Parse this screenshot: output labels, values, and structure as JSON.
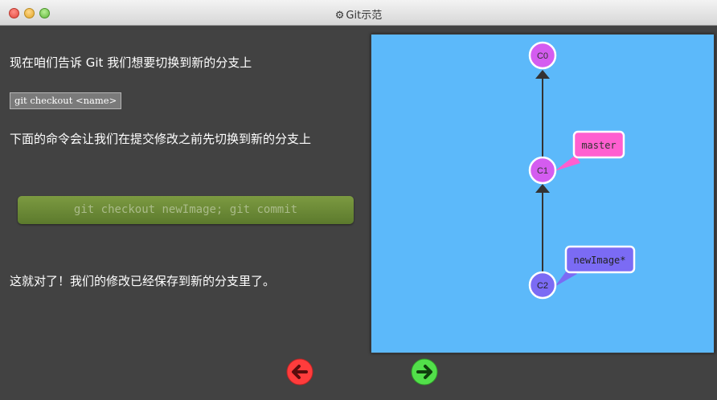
{
  "window": {
    "title": "Git示范",
    "title_icon": "gear-icon"
  },
  "dialog": {
    "paragraph_1": "现在咱们告诉 Git 我们想要切换到新的分支上",
    "code_example": "git checkout <name>",
    "paragraph_2": "下面的命令会让我们在提交修改之前先切换到新的分支上",
    "command": "git checkout newImage; git commit",
    "paragraph_3": "这就对了！我们的修改已经保存到新的分支里了。"
  },
  "navigation": {
    "prev_icon": "arrow-left-icon",
    "next_icon": "arrow-right-icon",
    "prev_color": "#ff3c3c",
    "next_color": "#52e04a"
  },
  "graph": {
    "commits": [
      {
        "id": "C0",
        "color": "#d45cf0"
      },
      {
        "id": "C1",
        "color": "#d45cf0"
      },
      {
        "id": "C2",
        "color": "#7b6bf4"
      }
    ],
    "branches": [
      {
        "label": "master",
        "target": "C1",
        "color": "#ff5fd0"
      },
      {
        "label": "newImage*",
        "target": "C2",
        "color": "#7b6bf4"
      }
    ],
    "background": "#5cb9fa"
  }
}
